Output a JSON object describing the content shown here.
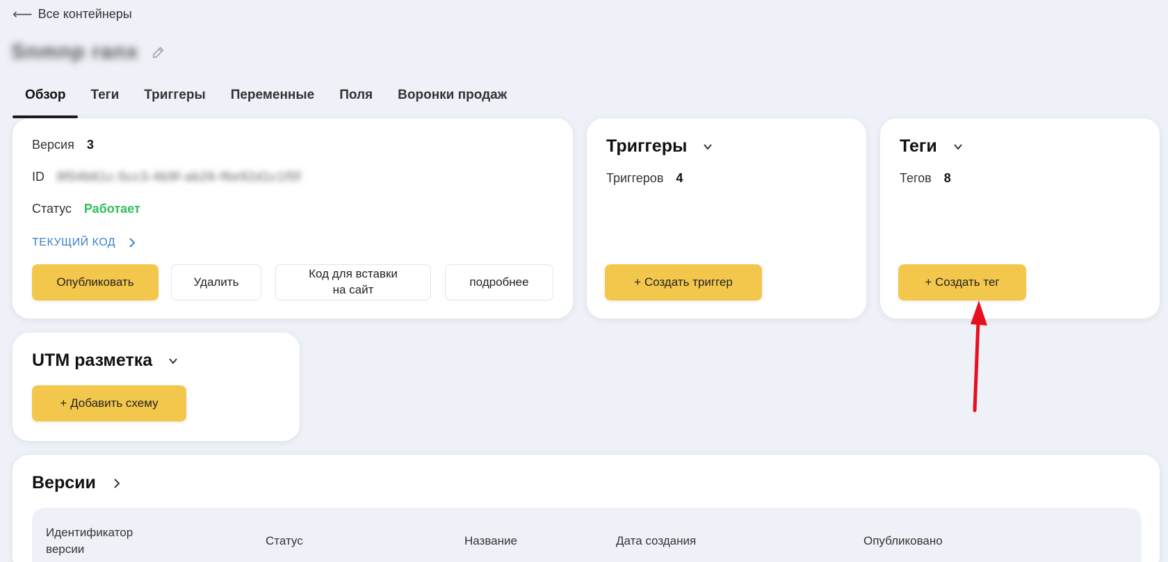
{
  "nav": {
    "back_label": "Все контейнеры"
  },
  "container": {
    "name": "Snmnp ranx"
  },
  "tabs": [
    "Обзор",
    "Теги",
    "Триггеры",
    "Переменные",
    "Поля",
    "Воронки продаж"
  ],
  "overview": {
    "version_label": "Версия",
    "version_value": "3",
    "id_label": "ID",
    "id_value": "8f04b61c-5cc3-4b9f-ab26-f6e92d1c1f0f",
    "status_label": "Статус",
    "status_value": "Работает",
    "current_code_link": "ТЕКУЩИЙ КОД",
    "publish_button": "Опубликовать",
    "delete_button": "Удалить",
    "embed_button_line1": "Код для вставки",
    "embed_button_line2": "на сайт",
    "more_button": "подробнее"
  },
  "triggers": {
    "title": "Триггеры",
    "count_label": "Триггеров",
    "count_value": "4",
    "create_button": "+ Создать триггер"
  },
  "tags": {
    "title": "Теги",
    "count_label": "Тегов",
    "count_value": "8",
    "create_button": "+ Создать тег"
  },
  "utm": {
    "title": "UTM разметка",
    "add_button": "+ Добавить схему"
  },
  "versions": {
    "title": "Версии",
    "columns": [
      "Идентификатор версии",
      "Статус",
      "Название",
      "Дата создания",
      "Опубликовано"
    ],
    "col0_line1": "Идентификатор",
    "col0_line2": "версии"
  },
  "colors": {
    "accent_yellow": "#f3c74b",
    "status_green": "#2fbf5a",
    "link_blue": "#3a83c6",
    "annotation_red": "#e8101e"
  },
  "icons": {
    "back": "arrow-left-icon",
    "edit": "pencil-icon",
    "chevron": "chevron-down-icon",
    "chevron_right": "chevron-right-icon"
  }
}
